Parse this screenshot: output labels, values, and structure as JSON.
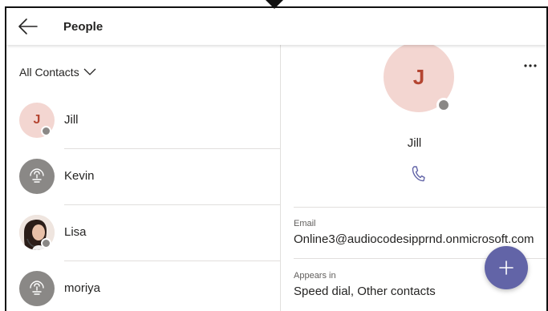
{
  "header": {
    "title": "People",
    "back_icon": "back-arrow-icon"
  },
  "filter": {
    "label": "All Contacts",
    "icon": "chevron-down-icon"
  },
  "contacts": [
    {
      "name": "Jill",
      "initial": "J",
      "avatar_type": "initial",
      "presence": "offline"
    },
    {
      "name": "Kevin",
      "avatar_type": "generic-handset",
      "presence": "none"
    },
    {
      "name": "Lisa",
      "avatar_type": "photo",
      "presence": "offline"
    },
    {
      "name": "moriya",
      "avatar_type": "generic-handset",
      "presence": "none"
    }
  ],
  "detail": {
    "initial": "J",
    "name": "Jill",
    "more_icon": "more-options-icon",
    "call_icon": "phone-icon",
    "email_label": "Email",
    "email_value": "Online3@audiocodesipprnd.onmicrosoft.com",
    "appears_label": "Appears in",
    "appears_value": "Speed dial, Other contacts"
  },
  "fab": {
    "icon": "plus-icon"
  },
  "colors": {
    "accent": "#6264a7",
    "avatar_bg": "#f3d6d1",
    "avatar_text": "#b44531",
    "presence_offline": "#8a8886",
    "call_icon": "#6264a7"
  }
}
